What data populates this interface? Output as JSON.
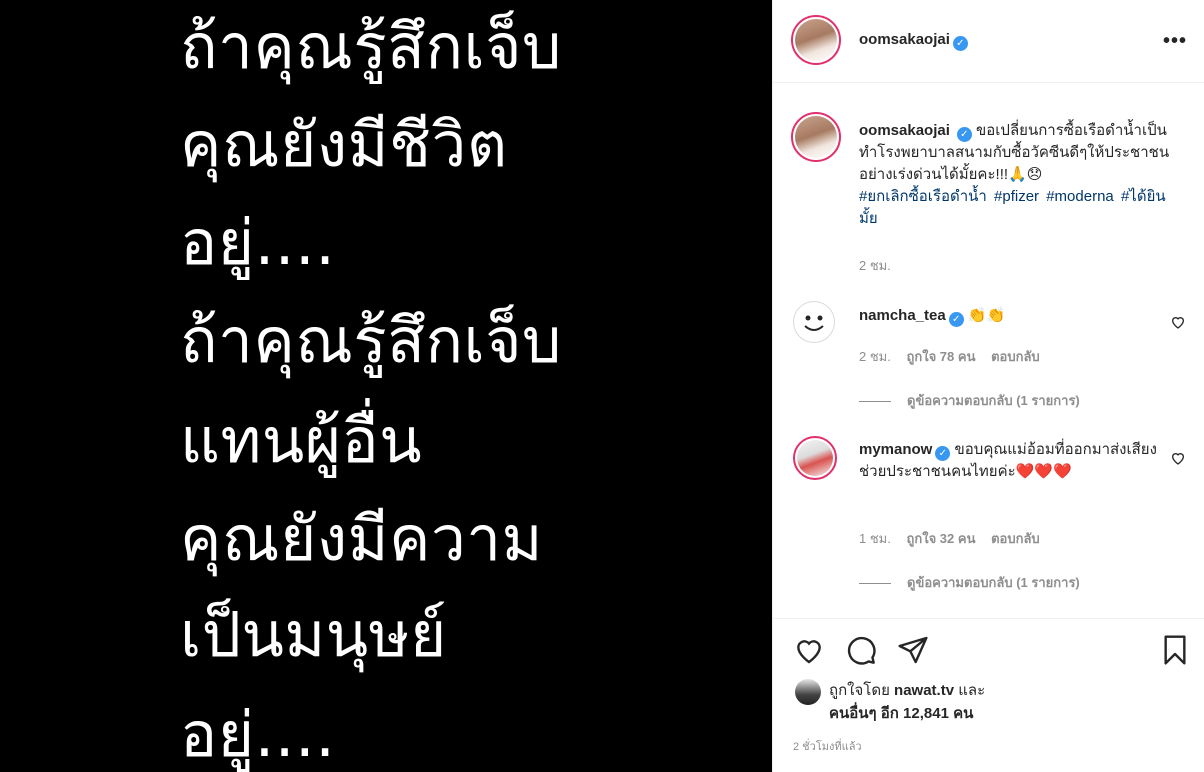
{
  "image_text": {
    "lines": [
      "ถ้าคุณรู้สึกเจ็บ",
      "คุณยังมีชีวิต",
      "อยู่....",
      "ถ้าคุณรู้สึกเจ็บ",
      "แทนผู้อื่น",
      "คุณยังมีความ",
      "เป็นมนุษย์",
      "อยู่...."
    ]
  },
  "header": {
    "username": "oomsakaojai",
    "verified_icon": "verified-badge-icon",
    "more_icon": "more-options-icon",
    "more_glyph": "•••"
  },
  "caption": {
    "username": "oomsakaojai",
    "text": "ขอเปลี่ยนการซื้อเรือดำน้ำเป็นทำโรงพยาบาลสนามกับซื้อวัคซีนดีๆให้ประชาชนอย่างเร่งด่วนได้มั้ยคะ!!!🙏😞",
    "hashtags": [
      "#ยกเลิกซื้อเรือดำน้ำ",
      "#pfizer",
      "#moderna",
      "#ได้ยินมั้ย"
    ],
    "time": "2 ชม."
  },
  "comments": [
    {
      "username": "namcha_tea",
      "text": "👏👏",
      "time": "2 ชม.",
      "likes": "ถูกใจ 78 คน",
      "reply": "ตอบกลับ",
      "view_replies": "ดูข้อความตอบกลับ (1 รายการ)"
    },
    {
      "username": "mymanow",
      "text": "ขอบคุณแม่อ้อมที่ออกมาส่งเสียงช่วยประชาชนคนไทยค่ะ❤️❤️❤️",
      "time": "1 ชม.",
      "likes": "ถูกใจ 32 คน",
      "reply": "ตอบกลับ",
      "view_replies": "ดูข้อความตอบกลับ (1 รายการ)"
    }
  ],
  "actions": {
    "like_icon": "heart-icon",
    "comment_icon": "comment-icon",
    "share_icon": "share-icon",
    "save_icon": "bookmark-icon"
  },
  "likes": {
    "liked_by_prefix": "ถูกใจโดย",
    "liked_by_user": "nawat.tv",
    "and": "และ",
    "others": "คนอื่นๆ อีก 12,841 คน"
  },
  "post_time": "2 ชั่วโมงที่แล้ว",
  "colors": {
    "verified": "#3897f0",
    "hashtag": "#00376b",
    "muted": "#8e8e8e",
    "text": "#262626",
    "heart_red": "#ed4956"
  }
}
